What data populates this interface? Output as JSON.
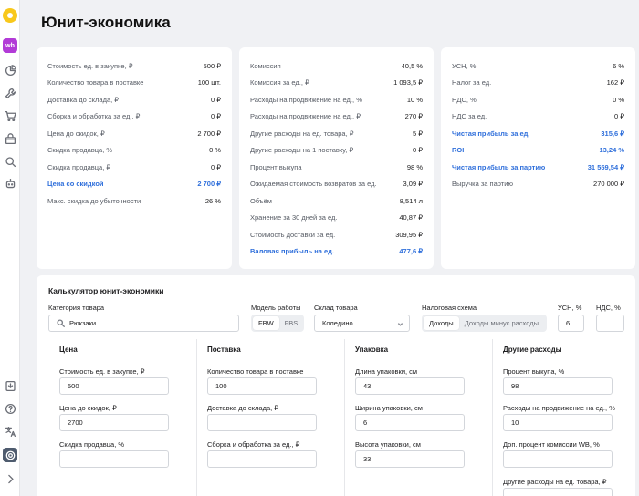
{
  "page": {
    "title": "Юнит-экономика"
  },
  "sidebar": {
    "brand_badge": "wb",
    "icons": [
      "logo-icon",
      "wb-icon",
      "chart-icon",
      "wrench-icon",
      "cart-icon",
      "bag-icon",
      "search-icon",
      "robot-icon",
      "download-icon",
      "help-icon",
      "translate-icon",
      "settings-icon",
      "chevron-right-icon"
    ]
  },
  "summary": {
    "col1": [
      {
        "label": "Стоимость ед. в закупке, ₽",
        "value": "500 ₽"
      },
      {
        "label": "Количество товара в поставке",
        "value": "100 шт."
      },
      {
        "label": "Доставка до склада, ₽",
        "value": "0 ₽"
      },
      {
        "label": "Сборка и обработка за ед., ₽",
        "value": "0 ₽"
      },
      {
        "label": "Цена до скидок, ₽",
        "value": "2 700 ₽"
      },
      {
        "label": "Скидка продавца, %",
        "value": "0 %"
      },
      {
        "label": "Скидка продавца, ₽",
        "value": "0 ₽"
      },
      {
        "label": "Цена со скидкой",
        "value": "2 700 ₽",
        "highlight": true
      },
      {
        "label": "Макс. скидка до убыточности",
        "value": "26 %"
      }
    ],
    "col2": [
      {
        "label": "Комиссия",
        "value": "40,5 %"
      },
      {
        "label": "Комиссия за ед., ₽",
        "value": "1 093,5 ₽"
      },
      {
        "label": "Расходы на продвижение на ед., %",
        "value": "10 %"
      },
      {
        "label": "Расходы на продвижение на ед., ₽",
        "value": "270 ₽"
      },
      {
        "label": "Другие расходы на ед. товара, ₽",
        "value": "5 ₽"
      },
      {
        "label": "Другие расходы на 1 поставку, ₽",
        "value": "0 ₽"
      },
      {
        "label": "Процент выкупа",
        "value": "98 %"
      },
      {
        "label": "Ожидаемая стоимость возвратов за ед.",
        "value": "3,09 ₽"
      },
      {
        "label": "Объём",
        "value": "8,514 л"
      },
      {
        "label": "Хранение за 30 дней за ед.",
        "value": "40,87 ₽"
      },
      {
        "label": "Стоимость доставки за ед.",
        "value": "309,95 ₽"
      },
      {
        "label": "Валовая прибыль на ед.",
        "value": "477,6 ₽",
        "highlight": true
      }
    ],
    "col3": [
      {
        "label": "УСН, %",
        "value": "6 %"
      },
      {
        "label": "Налог за ед.",
        "value": "162 ₽"
      },
      {
        "label": "НДС, %",
        "value": "0 %"
      },
      {
        "label": "НДС за ед.",
        "value": "0 ₽"
      },
      {
        "label": "Чистая прибыль за ед.",
        "value": "315,6 ₽",
        "highlight": true
      },
      {
        "label": "ROI",
        "value": "13,24 %",
        "highlight": true
      },
      {
        "label": "Чистая прибыль за партию",
        "value": "31 559,54 ₽",
        "highlight": true
      },
      {
        "label": "Выручка за партию",
        "value": "270 000 ₽"
      }
    ]
  },
  "calculator": {
    "title": "Калькулятор юнит-экономики",
    "category": {
      "label": "Категория товара",
      "value": "Рюкзаки"
    },
    "model": {
      "label": "Модель работы",
      "options": [
        "FBW",
        "FBS"
      ],
      "selected": "FBW"
    },
    "warehouse": {
      "label": "Склад товара",
      "value": "Коледино"
    },
    "tax_scheme": {
      "label": "Налоговая схема",
      "options": [
        "Доходы",
        "Доходы минус расходы"
      ],
      "selected": "Доходы"
    },
    "usn": {
      "label": "УСН, %",
      "value": "6"
    },
    "nds": {
      "label": "НДС, %",
      "value": ""
    },
    "price": {
      "heading": "Цена",
      "purchase_cost": {
        "label": "Стоимость ед. в закупке, ₽",
        "value": "500"
      },
      "price_before": {
        "label": "Цена до скидок, ₽",
        "value": "2700"
      },
      "seller_discount": {
        "label": "Скидка продавца, %",
        "value": ""
      }
    },
    "supply": {
      "heading": "Поставка",
      "quantity": {
        "label": "Количество товара в поставке",
        "value": "100"
      },
      "delivery": {
        "label": "Доставка до склада, ₽",
        "value": ""
      },
      "assembly": {
        "label": "Сборка и обработка за ед., ₽",
        "value": ""
      }
    },
    "package": {
      "heading": "Упаковка",
      "length": {
        "label": "Длина упаковки, см",
        "value": "43"
      },
      "width": {
        "label": "Ширина упаковки, см",
        "value": "6"
      },
      "height": {
        "label": "Высота упаковки, см",
        "value": "33"
      }
    },
    "other": {
      "heading": "Другие расходы",
      "buyout": {
        "label": "Процент выкупа, %",
        "value": "98"
      },
      "promo": {
        "label": "Расходы на продвижение на ед., %",
        "value": "10"
      },
      "extra_commission": {
        "label": "Доп. процент комиссии WB, %",
        "value": ""
      },
      "other_per_unit": {
        "label": "Другие расходы на ед. товара, ₽",
        "value": ""
      }
    }
  }
}
